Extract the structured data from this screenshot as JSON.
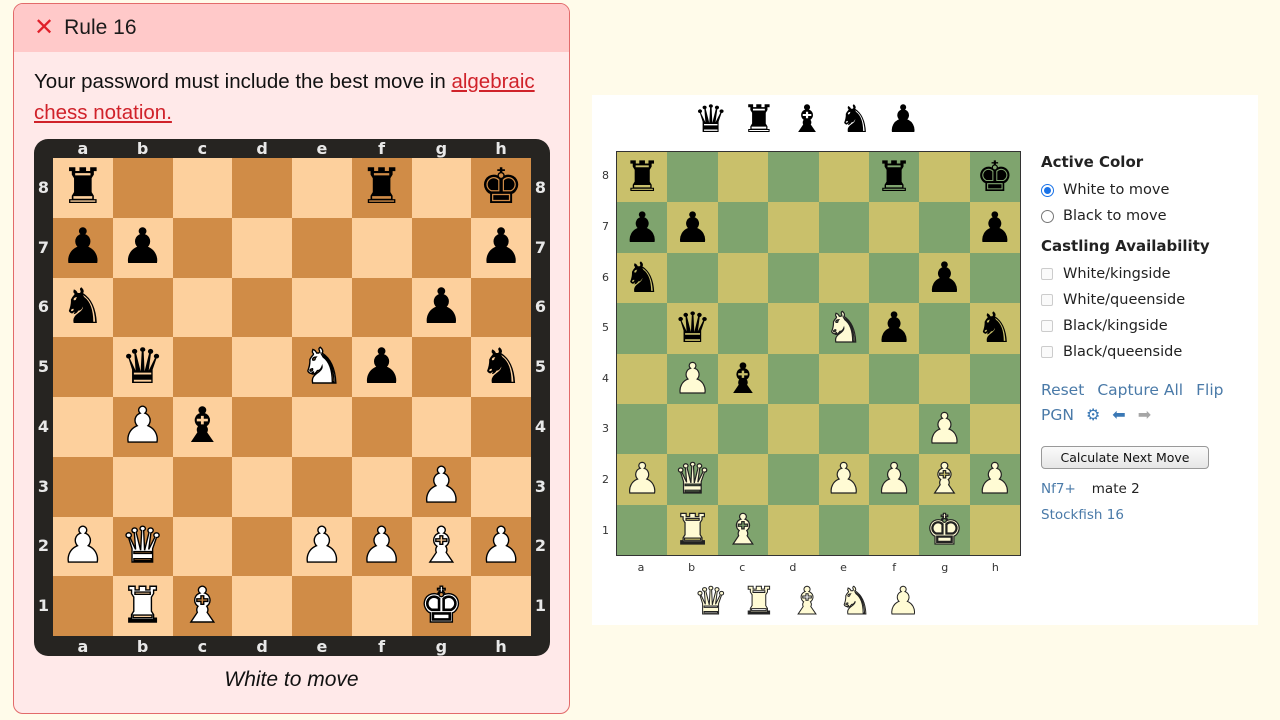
{
  "rule": {
    "title": "Rule 16",
    "status_icon": "x-icon",
    "text_before_link": "Your password must include the best move in ",
    "link_text": "algebraic chess notation.",
    "caption": "White to move",
    "colors": {
      "accent": "#e0202a",
      "header_bg": "#ffc9c9",
      "body_bg": "#ffe9e9",
      "light_square": "#fdd09d",
      "dark_square": "#d08c47"
    }
  },
  "position": {
    "files": [
      "a",
      "b",
      "c",
      "d",
      "e",
      "f",
      "g",
      "h"
    ],
    "ranks": [
      "8",
      "7",
      "6",
      "5",
      "4",
      "3",
      "2",
      "1"
    ],
    "rows": [
      [
        "r",
        "",
        "",
        "",
        "",
        "r",
        "",
        "k"
      ],
      [
        "p",
        "p",
        "",
        "",
        "",
        "",
        "",
        "p"
      ],
      [
        "n",
        "",
        "",
        "",
        "",
        "",
        "p",
        ""
      ],
      [
        "",
        "q",
        "",
        "",
        "N",
        "p",
        "",
        "n"
      ],
      [
        "",
        "P",
        "b",
        "",
        "",
        "",
        "",
        ""
      ],
      [
        "",
        "",
        "",
        "",
        "",
        "",
        "P",
        ""
      ],
      [
        "P",
        "Q",
        "",
        "",
        "P",
        "P",
        "B",
        "P"
      ],
      [
        "",
        "R",
        "B",
        "",
        "",
        "",
        "K",
        ""
      ]
    ]
  },
  "analysis": {
    "captured_black": [
      "q",
      "r",
      "b",
      "n",
      "p"
    ],
    "captured_white": [
      "Q",
      "R",
      "B",
      "N",
      "P"
    ],
    "active_color": {
      "heading": "Active Color",
      "options": [
        {
          "label": "White to move",
          "selected": true
        },
        {
          "label": "Black to move",
          "selected": false
        }
      ]
    },
    "castling": {
      "heading": "Castling Availability",
      "options": [
        {
          "label": "White/kingside",
          "checked": false
        },
        {
          "label": "White/queenside",
          "checked": false
        },
        {
          "label": "Black/kingside",
          "checked": false
        },
        {
          "label": "Black/queenside",
          "checked": false
        }
      ]
    },
    "links": {
      "reset": "Reset",
      "capture_all": "Capture All",
      "flip": "Flip",
      "pgn": "PGN"
    },
    "icons": {
      "settings": "gear-icon",
      "back": "arrow-left-icon",
      "forward": "arrow-right-icon"
    },
    "calculate_button": "Calculate Next Move",
    "best_move": "Nf7+",
    "evaluation": "mate 2",
    "engine": "Stockfish 16",
    "colors": {
      "light_square": "#c9c06b",
      "dark_square": "#7fa46e",
      "link": "#4a7aa8"
    }
  }
}
